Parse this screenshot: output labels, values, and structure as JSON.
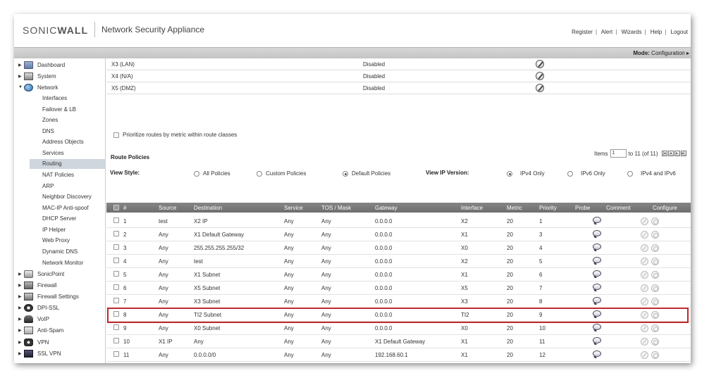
{
  "header": {
    "brand": "SONICWALL",
    "product": "Network Security Appliance",
    "links": [
      "Register",
      "Alert",
      "Wizards",
      "Help",
      "Logout"
    ]
  },
  "modebar": {
    "mode_label": "Mode:",
    "mode_value": "Configuration ▸"
  },
  "sidebar": {
    "sections": [
      {
        "label": "Dashboard",
        "icon": "dashboard-icon",
        "expanded": false
      },
      {
        "label": "System",
        "icon": "system-icon",
        "expanded": false
      },
      {
        "label": "Network",
        "icon": "network-globe-icon",
        "expanded": true
      }
    ],
    "network_items": [
      "Interfaces",
      "Failover & LB",
      "Zones",
      "DNS",
      "Address Objects",
      "Services",
      "Routing",
      "NAT Policies",
      "ARP",
      "Neighbor Discovery",
      "MAC-IP Anti-spoof",
      "DHCP Server",
      "IP Helper",
      "Web Proxy",
      "Dynamic DNS",
      "Network Monitor"
    ],
    "active_item": "Routing",
    "bottom_sections": [
      {
        "label": "SonicPoint",
        "icon": "sonicpoint-icon"
      },
      {
        "label": "Firewall",
        "icon": "firewall-icon"
      },
      {
        "label": "Firewall Settings",
        "icon": "firewall-settings-icon"
      },
      {
        "label": "DPI-SSL",
        "icon": "dpi-ssl-icon"
      },
      {
        "label": "VoIP",
        "icon": "voip-icon"
      },
      {
        "label": "Anti-Spam",
        "icon": "anti-spam-icon"
      },
      {
        "label": "VPN",
        "icon": "vpn-icon"
      },
      {
        "label": "SSL VPN",
        "icon": "ssl-vpn-icon"
      }
    ]
  },
  "interfaces": [
    {
      "name": "X3 (LAN)",
      "status": "Disabled"
    },
    {
      "name": "X4 (N/A)",
      "status": "Disabled"
    },
    {
      "name": "X5 (DMZ)",
      "status": "Disabled"
    }
  ],
  "prioritize_label": "Prioritize routes by metric within route classes",
  "route_policies": {
    "title": "Route Policies",
    "items_label": "Items",
    "items_value": "1",
    "items_suffix": "to 11 (of 11)",
    "pager": [
      "|◂",
      "◂",
      "▸",
      "▸|"
    ],
    "view_style_label": "View Style:",
    "view_styles": [
      "All Policies",
      "Custom Policies",
      "Default Policies"
    ],
    "view_style_selected": "Default Policies",
    "ip_version_label": "View IP Version:",
    "ip_versions": [
      "IPv4 Only",
      "IPv6 Only",
      "IPv4 and IPv6"
    ],
    "ip_version_selected": "IPv4 Only",
    "columns": [
      "#",
      "Source",
      "Destination",
      "Service",
      "TOS / Mask",
      "Gateway",
      "Interface",
      "Metric",
      "Priority",
      "Probe",
      "Comment",
      "Configure"
    ],
    "rows": [
      [
        "1",
        "test",
        "X2 IP",
        "Any",
        "Any",
        "0.0.0.0",
        "X2",
        "20",
        "1",
        ""
      ],
      [
        "2",
        "Any",
        "X1 Default Gateway",
        "Any",
        "Any",
        "0.0.0.0",
        "X1",
        "20",
        "3",
        ""
      ],
      [
        "3",
        "Any",
        "255.255.255.255/32",
        "Any",
        "Any",
        "0.0.0.0",
        "X0",
        "20",
        "4",
        ""
      ],
      [
        "4",
        "Any",
        "test",
        "Any",
        "Any",
        "0.0.0.0",
        "X2",
        "20",
        "5",
        ""
      ],
      [
        "5",
        "Any",
        "X1 Subnet",
        "Any",
        "Any",
        "0.0.0.0",
        "X1",
        "20",
        "6",
        ""
      ],
      [
        "6",
        "Any",
        "X5 Subnet",
        "Any",
        "Any",
        "0.0.0.0",
        "X5",
        "20",
        "7",
        ""
      ],
      [
        "7",
        "Any",
        "X3 Subnet",
        "Any",
        "Any",
        "0.0.0.0",
        "X3",
        "20",
        "8",
        ""
      ],
      [
        "8",
        "Any",
        "TI2 Subnet",
        "Any",
        "Any",
        "0.0.0.0",
        "TI2",
        "20",
        "9",
        ""
      ],
      [
        "9",
        "Any",
        "X0 Subnet",
        "Any",
        "Any",
        "0.0.0.0",
        "X0",
        "20",
        "10",
        ""
      ],
      [
        "10",
        "X1 IP",
        "Any",
        "Any",
        "Any",
        "X1 Default Gateway",
        "X1",
        "20",
        "11",
        ""
      ],
      [
        "11",
        "Any",
        "0.0.0.0/0",
        "Any",
        "Any",
        "192.168.60.1",
        "X1",
        "20",
        "12",
        ""
      ]
    ],
    "highlighted_row": "8",
    "highlight_color": "#c0272d"
  }
}
